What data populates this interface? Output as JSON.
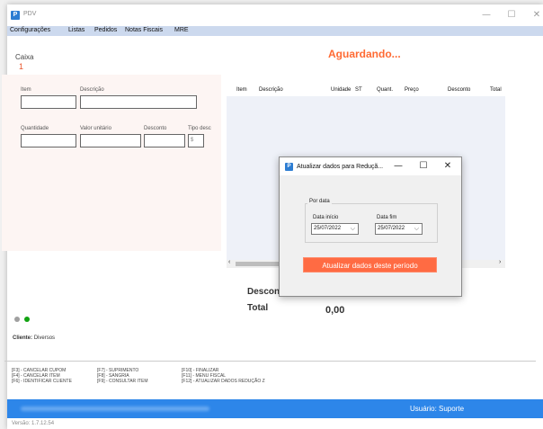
{
  "window": {
    "title": "PDV",
    "app_icon": "pdv-app-icon",
    "controls": [
      "—",
      "☐",
      "✕"
    ]
  },
  "menu": {
    "items": [
      "Configurações",
      "Listas",
      "Pedidos",
      "Notas Fiscais",
      "MRE"
    ]
  },
  "caixa": {
    "label": "Caixa",
    "number": "1"
  },
  "status_text": "Aguardando...",
  "item_form": {
    "item_label": "Item",
    "descricao_label": "Descrição",
    "quantidade_label": "Quantidade",
    "valor_unitario_label": "Valor unitário",
    "desconto_label": "Desconto",
    "tipo_desc_label": "Tipo desc",
    "tipo_desc_value": "$"
  },
  "grid": {
    "columns": [
      "Item",
      "Descrição",
      "Unidade",
      "ST",
      "Quant.",
      "Preço",
      "Desconto",
      "Total"
    ],
    "scroll_left": "‹",
    "scroll_right": "›"
  },
  "totals": {
    "desconto_label": "Descon",
    "total_label": "Total",
    "total_value": "0,00"
  },
  "indicators": {
    "colors": [
      "#a0a0a0",
      "#12a312"
    ]
  },
  "cliente": {
    "label": "Cliente:",
    "value": "Diversos"
  },
  "shortcuts": {
    "col1": [
      "[F3] - CANCELAR CUPOM",
      "[F4] - CANCELAR ITEM",
      "[F6] - IDENTIFICAR CLIENTE"
    ],
    "col2": [
      "[F7] - SUPRIMENTO",
      "[F8] - SANGRIA",
      "[F9] - CONSULTAR ITEM"
    ],
    "col3": [
      "[F10] - FINALIZAR",
      "[F11] - MENU FISCAL",
      "[F12] - ATUALIZAR DADOS REDUÇÃO Z"
    ]
  },
  "footer": {
    "usuario": "Usuário: Suporte"
  },
  "version": "Versão: 1.7.12.54",
  "dialog": {
    "title": "Atualizar dados para Reduçã...",
    "controls": [
      "—",
      "☐",
      "✕"
    ],
    "group_label": "Por data",
    "data_inicio_label": "Data início",
    "data_inicio_value": "25/07/2022",
    "data_fim_label": "Data fim",
    "data_fim_value": "25/07/2022",
    "button_label": "Atualizar dados deste período"
  },
  "colors": {
    "accent": "#ff6a33",
    "menubar": "#ccd9ee",
    "footer": "#2d86e9",
    "button": "#ff6b43"
  }
}
